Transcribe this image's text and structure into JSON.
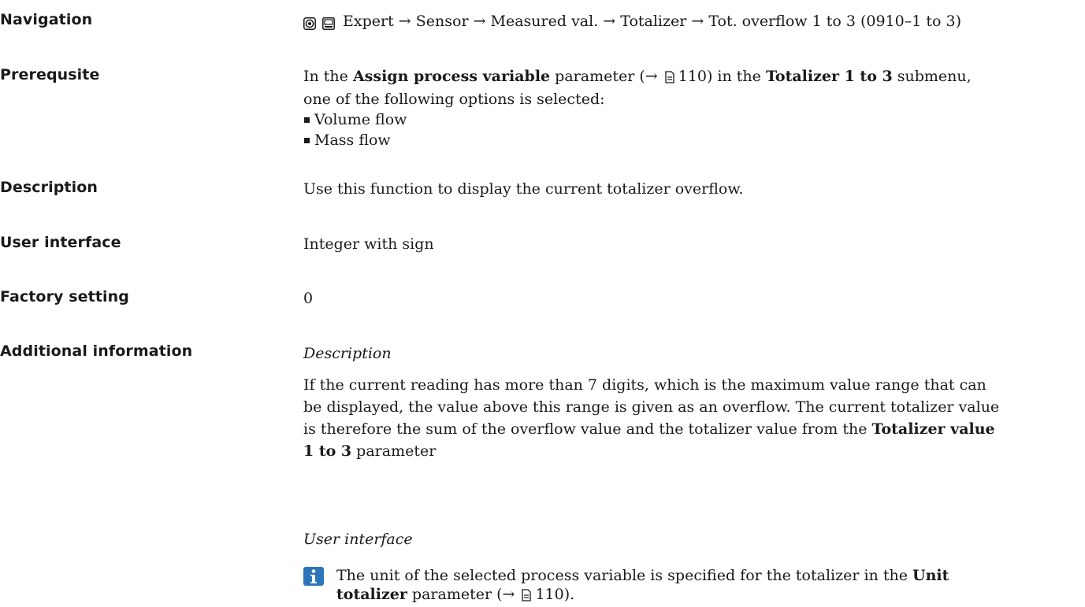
{
  "navigation": {
    "label": "Navigation",
    "path": "Expert → Sensor → Measured val. → Totalizer → Tot. overflow 1 to 3 (0910–1 to 3)"
  },
  "prerequisite": {
    "label": "Prerequsite",
    "text_1": "In the ",
    "param_1": "Assign process variable",
    "text_2": " parameter (→ ",
    "ref_1": "110",
    "text_3": ") in the ",
    "param_2": "Totalizer 1 to 3",
    "text_4": " submenu,",
    "text_5": "one of the following options is selected:",
    "options": [
      "Volume flow",
      "Mass flow"
    ]
  },
  "description": {
    "label": "Description",
    "text": "Use this function to display the current totalizer overflow."
  },
  "user_interface": {
    "label": "User interface",
    "text": "Integer with sign"
  },
  "factory_setting": {
    "label": "Factory setting",
    "text": "0"
  },
  "additional_information": {
    "label": "Additional information",
    "desc_heading": "Description",
    "desc_line_1": "If the current reading has more than 7 digits, which is the maximum value range that can",
    "desc_line_2": "be displayed, the value above this range is given as an overflow. The current totalizer value",
    "desc_line_3a": "is therefore the sum of the overflow value and the totalizer value from the ",
    "desc_param_a": "Totalizer value",
    "desc_param_b": "1 to 3",
    "desc_line_4": " parameter",
    "ui_heading": "User interface",
    "note_text_1": "The unit of the selected process variable is specified for the totalizer in the ",
    "note_param_a": "Unit",
    "note_param_b": "totalizer",
    "note_text_2": " parameter (→ ",
    "note_ref": "110",
    "note_text_3": ")."
  }
}
